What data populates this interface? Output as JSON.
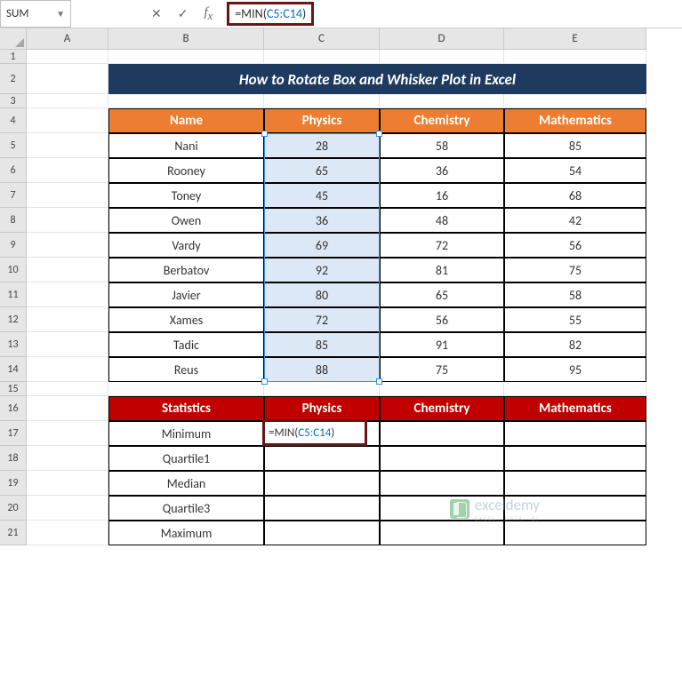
{
  "name_box": "SUM",
  "formula": "=MIN(C5:C14)",
  "formula_prefix": "=MIN(",
  "formula_ref": "C5:C14",
  "formula_suffix": ")",
  "columns": [
    "A",
    "B",
    "C",
    "D",
    "E"
  ],
  "row_numbers": [
    "1",
    "2",
    "3",
    "4",
    "5",
    "6",
    "7",
    "8",
    "9",
    "10",
    "11",
    "12",
    "13",
    "14",
    "15",
    "16",
    "17",
    "18",
    "19",
    "20",
    "21"
  ],
  "title": "How to  Rotate Box and Whisker Plot in Excel",
  "table1": {
    "headers": [
      "Name",
      "Physics",
      "Chemistry",
      "Mathematics"
    ],
    "rows": [
      [
        "Nani",
        "28",
        "58",
        "85"
      ],
      [
        "Rooney",
        "65",
        "36",
        "54"
      ],
      [
        "Toney",
        "45",
        "16",
        "68"
      ],
      [
        "Owen",
        "36",
        "48",
        "42"
      ],
      [
        "Vardy",
        "69",
        "72",
        "56"
      ],
      [
        "Berbatov",
        "92",
        "81",
        "75"
      ],
      [
        "Javier",
        "80",
        "65",
        "58"
      ],
      [
        "Xames",
        "72",
        "56",
        "55"
      ],
      [
        "Tadic",
        "85",
        "91",
        "82"
      ],
      [
        "Reus",
        "88",
        "75",
        "95"
      ]
    ]
  },
  "table2": {
    "headers": [
      "Statistics",
      "Physics",
      "Chemistry",
      "Mathematics"
    ],
    "rows": [
      "Minimum",
      "Quartile1",
      "Median",
      "Quartile3",
      "Maximum"
    ]
  },
  "edit_value_prefix": "=MIN(",
  "edit_value_ref": "C5:C14",
  "edit_value_suffix": ")",
  "watermark": {
    "brand": "exceldemy",
    "tag": "EXCEL · DATA · BI"
  },
  "chart_data": {
    "type": "table",
    "title": "How to Rotate Box and Whisker Plot in Excel",
    "columns": [
      "Name",
      "Physics",
      "Chemistry",
      "Mathematics"
    ],
    "rows": [
      {
        "Name": "Nani",
        "Physics": 28,
        "Chemistry": 58,
        "Mathematics": 85
      },
      {
        "Name": "Rooney",
        "Physics": 65,
        "Chemistry": 36,
        "Mathematics": 54
      },
      {
        "Name": "Toney",
        "Physics": 45,
        "Chemistry": 16,
        "Mathematics": 68
      },
      {
        "Name": "Owen",
        "Physics": 36,
        "Chemistry": 48,
        "Mathematics": 42
      },
      {
        "Name": "Vardy",
        "Physics": 69,
        "Chemistry": 72,
        "Mathematics": 56
      },
      {
        "Name": "Berbatov",
        "Physics": 92,
        "Chemistry": 81,
        "Mathematics": 75
      },
      {
        "Name": "Javier",
        "Physics": 80,
        "Chemistry": 65,
        "Mathematics": 58
      },
      {
        "Name": "Xames",
        "Physics": 72,
        "Chemistry": 56,
        "Mathematics": 55
      },
      {
        "Name": "Tadic",
        "Physics": 85,
        "Chemistry": 91,
        "Mathematics": 82
      },
      {
        "Name": "Reus",
        "Physics": 88,
        "Chemistry": 75,
        "Mathematics": 95
      }
    ],
    "statistics_rows": [
      "Minimum",
      "Quartile1",
      "Median",
      "Quartile3",
      "Maximum"
    ],
    "active_formula": "=MIN(C5:C14)"
  }
}
